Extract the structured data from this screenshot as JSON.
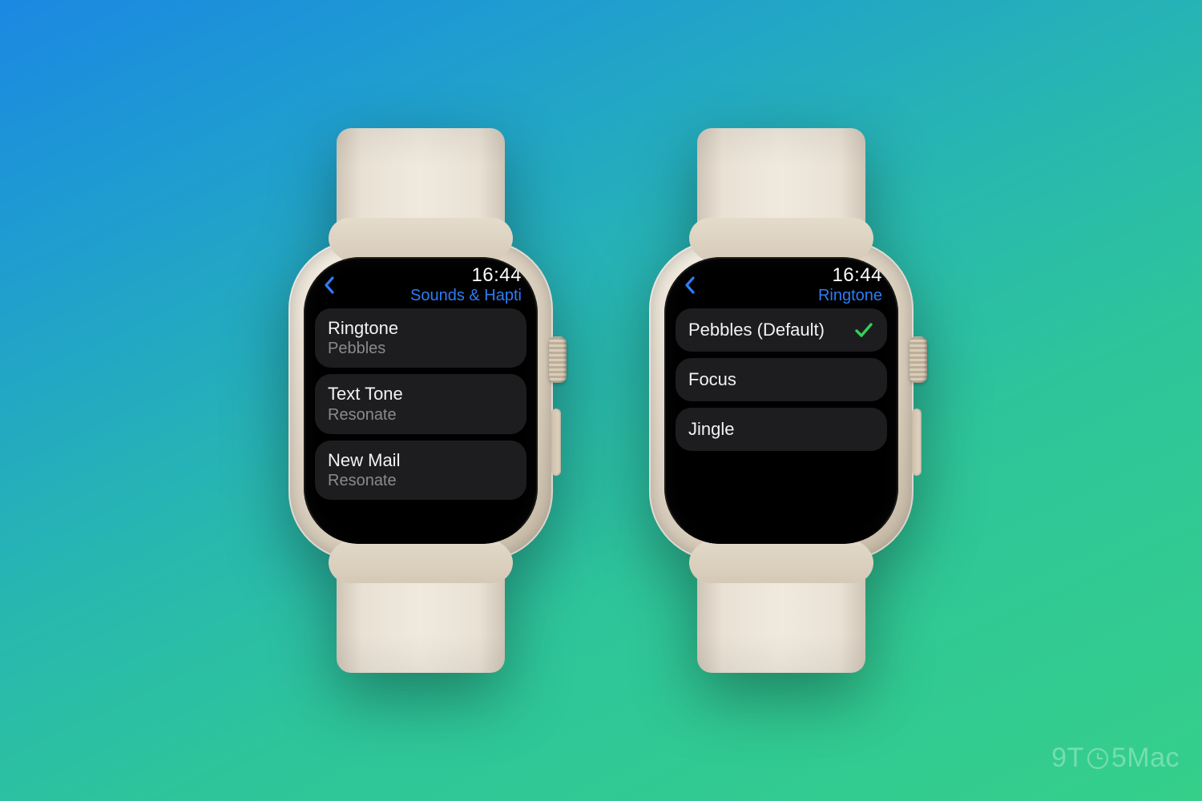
{
  "watermark": {
    "prefix": "9T",
    "suffix": "5Mac"
  },
  "watches": {
    "left": {
      "clock": "16:44",
      "title": "Sounds & Hapti",
      "rows": [
        {
          "primary": "Ringtone",
          "secondary": "Pebbles"
        },
        {
          "primary": "Text Tone",
          "secondary": "Resonate"
        },
        {
          "primary": "New Mail",
          "secondary": "Resonate"
        }
      ]
    },
    "right": {
      "clock": "16:44",
      "title": "Ringtone",
      "rows": [
        {
          "primary": "Pebbles (Default)",
          "selected": true
        },
        {
          "primary": "Focus"
        },
        {
          "primary": "Jingle"
        }
      ]
    }
  }
}
